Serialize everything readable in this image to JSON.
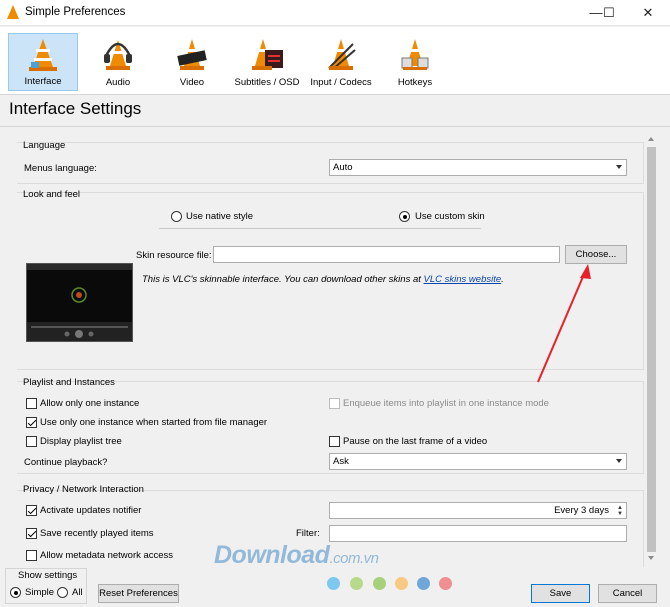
{
  "window": {
    "title": "Simple Preferences",
    "minimize": "—",
    "maximize": "☐",
    "close": "✕"
  },
  "categories": [
    {
      "label": "Interface",
      "icon": "interface-cone-icon",
      "selected": true
    },
    {
      "label": "Audio",
      "icon": "audio-headphones-cone-icon",
      "selected": false
    },
    {
      "label": "Video",
      "icon": "video-cone-icon",
      "selected": false
    },
    {
      "label": "Subtitles / OSD",
      "icon": "subtitles-cone-icon",
      "selected": false
    },
    {
      "label": "Input / Codecs",
      "icon": "input-codecs-cone-icon",
      "selected": false
    },
    {
      "label": "Hotkeys",
      "icon": "hotkeys-cone-icon",
      "selected": false
    }
  ],
  "page_title": "Interface Settings",
  "language": {
    "title": "Language",
    "menus_label": "Menus language:",
    "menus_value": "Auto"
  },
  "look": {
    "title": "Look and feel",
    "native_label": "Use native style",
    "custom_label": "Use custom skin",
    "selected_style": "custom",
    "skin_file_label": "Skin resource file:",
    "skin_file_value": "",
    "choose_label": "Choose...",
    "info_text": "This is VLC's skinnable interface. You can download other skins at ",
    "info_link": "VLC skins website",
    "info_end": "."
  },
  "playlist": {
    "title": "Playlist and Instances",
    "one_instance": "Allow only one instance",
    "one_instance_checked": false,
    "enqueue": "Enqueue items into playlist in one instance mode",
    "enqueue_checked": false,
    "file_manager": "Use only one instance when started from file manager",
    "file_manager_checked": true,
    "display_tree": "Display playlist tree",
    "display_tree_checked": false,
    "pause_last": "Pause on the last frame of a video",
    "pause_last_checked": false,
    "continue_label": "Continue playback?",
    "continue_value": "Ask"
  },
  "privacy": {
    "title": "Privacy / Network Interaction",
    "updates": "Activate updates notifier",
    "updates_checked": true,
    "updates_interval": "Every 3 days",
    "recent": "Save recently played items",
    "recent_checked": true,
    "filter_label": "Filter:",
    "filter_value": "",
    "metadata": "Allow metadata network access",
    "metadata_checked": false
  },
  "show_settings": {
    "title": "Show settings",
    "simple": "Simple",
    "all": "All",
    "selected": "simple"
  },
  "buttons": {
    "reset": "Reset Preferences",
    "save": "Save",
    "cancel": "Cancel"
  },
  "watermark": {
    "brand": "Download",
    "domain": ".com.vn"
  },
  "colors": {
    "accent_arrow": "#e8202a",
    "selected_category": "#cce4f7",
    "link": "#0645ad"
  }
}
